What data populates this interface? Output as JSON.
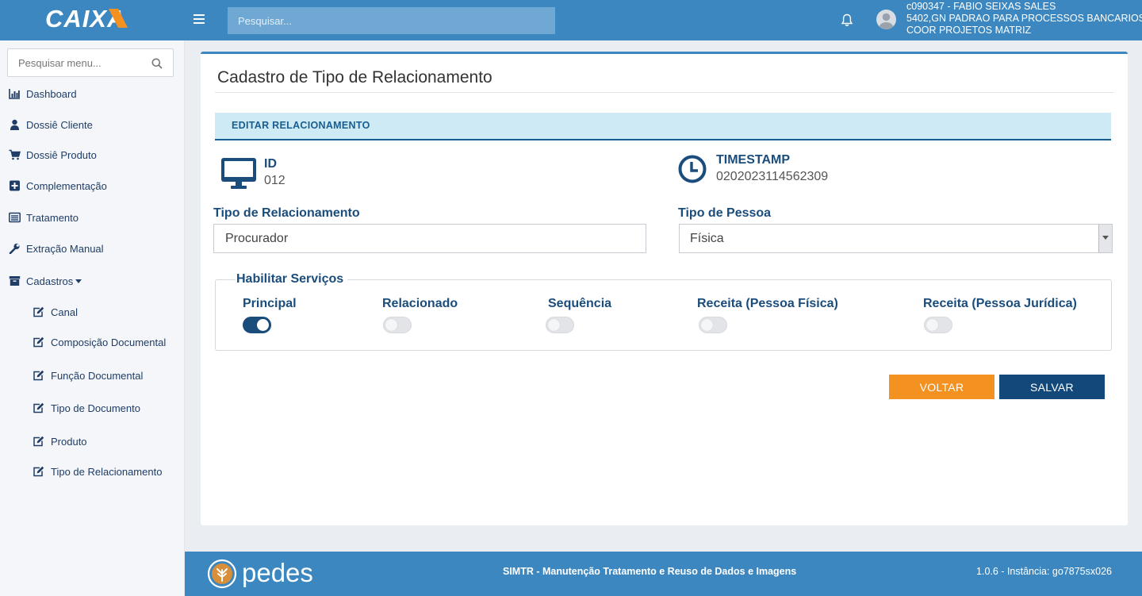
{
  "header": {
    "brand": "CAIXA",
    "search_placeholder": "Pesquisar...",
    "user": {
      "line1": "c090347 - FABIO SEIXAS SALES",
      "line2": "5402,GN PADRAO PARA PROCESSOS BANCARIOS",
      "line3": "COOR PROJETOS MATRIZ"
    },
    "colors": {
      "bar": "#3c87bf"
    }
  },
  "sidebar": {
    "search_placeholder": "Pesquisar menu...",
    "items": [
      {
        "label": "Dashboard",
        "icon": "bar-chart-icon"
      },
      {
        "label": "Dossiê Cliente",
        "icon": "user-icon"
      },
      {
        "label": "Dossiê Produto",
        "icon": "cart-icon"
      },
      {
        "label": "Complementação",
        "icon": "plus-square-icon"
      },
      {
        "label": "Tratamento",
        "icon": "list-icon"
      },
      {
        "label": "Extração Manual",
        "icon": "wrench-icon"
      },
      {
        "label": "Cadastros",
        "icon": "archive-icon",
        "expanded": true
      }
    ],
    "subitems": [
      {
        "label": "Canal",
        "icon": "edit-icon"
      },
      {
        "label": "Composição Documental",
        "icon": "edit-icon"
      },
      {
        "label": "Função Documental",
        "icon": "edit-icon"
      },
      {
        "label": "Tipo de Documento",
        "icon": "edit-icon"
      },
      {
        "label": "Produto",
        "icon": "edit-icon"
      },
      {
        "label": "Tipo de Relacionamento",
        "icon": "edit-icon"
      }
    ]
  },
  "main": {
    "title": "Cadastro de Tipo de Relacionamento",
    "section_title": "EDITAR RELACIONAMENTO",
    "id": {
      "label": "ID",
      "value": "012",
      "icon": "monitor-icon"
    },
    "timestamp": {
      "label": "TIMESTAMP",
      "value": "0202023114562309",
      "icon": "clock-icon"
    },
    "tipo_relacionamento": {
      "label": "Tipo de Relacionamento",
      "value": "Procurador"
    },
    "tipo_pessoa": {
      "label": "Tipo de Pessoa",
      "value": "Física"
    },
    "servicos": {
      "legend": "Habilitar Serviços",
      "toggles": [
        {
          "label": "Principal",
          "on": true
        },
        {
          "label": "Relacionado",
          "on": false
        },
        {
          "label": "Sequência",
          "on": false
        },
        {
          "label": "Receita (Pessoa Física)",
          "on": false
        },
        {
          "label": "Receita (Pessoa Jurídica)",
          "on": false
        }
      ]
    },
    "buttons": {
      "back": "VOLTAR",
      "save": "SALVAR"
    },
    "colors": {
      "accent": "#1a4c7c",
      "back": "#f39121",
      "save": "#13497a",
      "section_bg": "#cdeaf5"
    }
  },
  "footer": {
    "logo_text": "pedes",
    "center": "SIMTR - Manutenção Tratamento e Reuso de Dados e Imagens",
    "right": "1.0.6 - Instância: go7875sx026"
  }
}
